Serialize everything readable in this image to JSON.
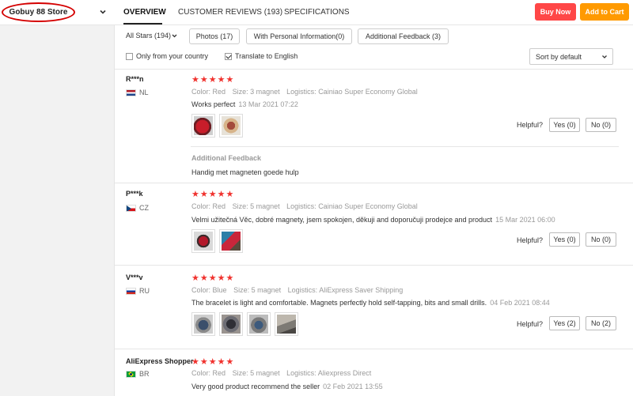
{
  "store": {
    "name": "Gobuy 88 Store"
  },
  "tabs": [
    {
      "label": "OVERVIEW"
    },
    {
      "label": "CUSTOMER REVIEWS (193)"
    },
    {
      "label": "SPECIFICATIONS"
    }
  ],
  "actions": {
    "buy_now": "Buy Now",
    "add_to_cart": "Add to Cart"
  },
  "filters": {
    "all_stars": "All Stars (194)",
    "photos": "Photos (17)",
    "personal_info": "With Personal Information(0)",
    "additional_feedback": "Additional Feedback (3)",
    "only_country": "Only from your country",
    "translate": "Translate to English",
    "sort": "Sort by default"
  },
  "labels": {
    "color": "Color:",
    "size": "Size:",
    "logistics": "Logistics:",
    "helpful": "Helpful?",
    "additional_feedback_heading": "Additional Feedback"
  },
  "reviews": [
    {
      "name": "R***n",
      "country": "NL",
      "stars": "★★★★★",
      "color": "Red",
      "size": "3 magnet",
      "logistics": "Cainiao Super Economy Global",
      "text": "Works perfect",
      "date": "13 Mar 2021 07:22",
      "yes": "Yes (0)",
      "no": "No (0)",
      "additional_feedback": "Handig met magneten goede hulp"
    },
    {
      "name": "P***k",
      "country": "CZ",
      "stars": "★★★★★",
      "color": "Red",
      "size": "5 magnet",
      "logistics": "Cainiao Super Economy Global",
      "text": "Velmi užitečná Věc, dobré magnety, jsem spokojen, děkuji and doporučuji prodejce and product",
      "date": "15 Mar 2021 06:00",
      "yes": "Yes (0)",
      "no": "No (0)"
    },
    {
      "name": "V***v",
      "country": "RU",
      "stars": "★★★★★",
      "color": "Blue",
      "size": "5 magnet",
      "logistics": "AliExpress Saver Shipping",
      "text": "The bracelet is light and comfortable. Magnets perfectly hold self-tapping, bits and small drills.",
      "date": "04 Feb 2021 08:44",
      "yes": "Yes (2)",
      "no": "No (2)"
    },
    {
      "name": "AliExpress Shopper",
      "country": "BR",
      "stars": "★★★★★",
      "color": "Red",
      "size": "5 magnet",
      "logistics": "Aliexpress Direct",
      "text": "Very good product recommend the seller",
      "date": "02 Feb 2021 13:55"
    }
  ],
  "colors": {
    "buy_now": "#ff4747",
    "add_to_cart": "#ff9a00",
    "stars": "#f0322e",
    "store_highlight": "#d40000"
  }
}
